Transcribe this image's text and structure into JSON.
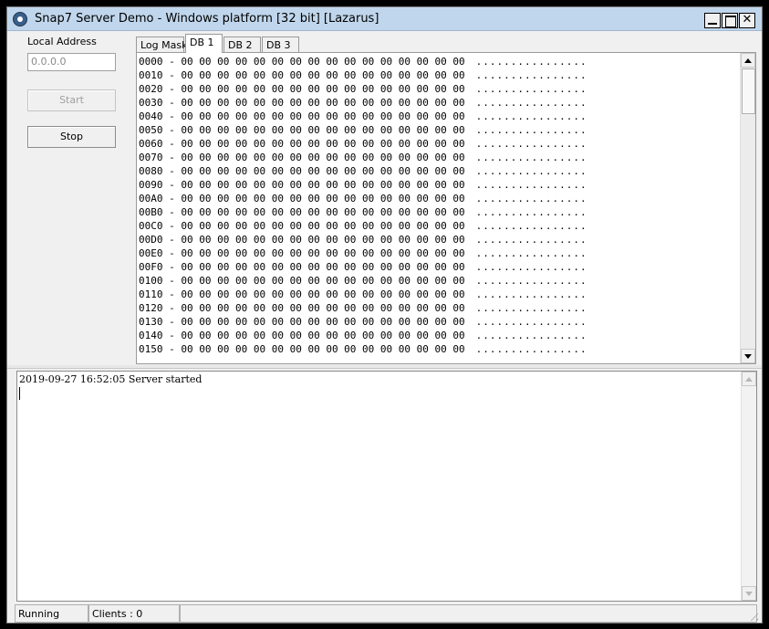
{
  "window": {
    "title": "Snap7 Server Demo - Windows platform [32 bit] [Lazarus]",
    "icon": "snap7-app-icon"
  },
  "controls": {
    "local_address_label": "Local Address",
    "local_address_value": "0.0.0.0",
    "start_label": "Start",
    "stop_label": "Stop"
  },
  "tabs": [
    {
      "label": "Log Mask",
      "active": false
    },
    {
      "label": "DB 1",
      "active": true
    },
    {
      "label": "DB 2",
      "active": false
    },
    {
      "label": "DB 3",
      "active": false
    }
  ],
  "hex_view": {
    "rows": [
      {
        "offset": "0000",
        "bytes": "00 00 00 00 00 00 00 00 00 00 00 00 00 00 00 00",
        "ascii": "................"
      },
      {
        "offset": "0010",
        "bytes": "00 00 00 00 00 00 00 00 00 00 00 00 00 00 00 00",
        "ascii": "................"
      },
      {
        "offset": "0020",
        "bytes": "00 00 00 00 00 00 00 00 00 00 00 00 00 00 00 00",
        "ascii": "................"
      },
      {
        "offset": "0030",
        "bytes": "00 00 00 00 00 00 00 00 00 00 00 00 00 00 00 00",
        "ascii": "................"
      },
      {
        "offset": "0040",
        "bytes": "00 00 00 00 00 00 00 00 00 00 00 00 00 00 00 00",
        "ascii": "................"
      },
      {
        "offset": "0050",
        "bytes": "00 00 00 00 00 00 00 00 00 00 00 00 00 00 00 00",
        "ascii": "................"
      },
      {
        "offset": "0060",
        "bytes": "00 00 00 00 00 00 00 00 00 00 00 00 00 00 00 00",
        "ascii": "................"
      },
      {
        "offset": "0070",
        "bytes": "00 00 00 00 00 00 00 00 00 00 00 00 00 00 00 00",
        "ascii": "................"
      },
      {
        "offset": "0080",
        "bytes": "00 00 00 00 00 00 00 00 00 00 00 00 00 00 00 00",
        "ascii": "................"
      },
      {
        "offset": "0090",
        "bytes": "00 00 00 00 00 00 00 00 00 00 00 00 00 00 00 00",
        "ascii": "................"
      },
      {
        "offset": "00A0",
        "bytes": "00 00 00 00 00 00 00 00 00 00 00 00 00 00 00 00",
        "ascii": "................"
      },
      {
        "offset": "00B0",
        "bytes": "00 00 00 00 00 00 00 00 00 00 00 00 00 00 00 00",
        "ascii": "................"
      },
      {
        "offset": "00C0",
        "bytes": "00 00 00 00 00 00 00 00 00 00 00 00 00 00 00 00",
        "ascii": "................"
      },
      {
        "offset": "00D0",
        "bytes": "00 00 00 00 00 00 00 00 00 00 00 00 00 00 00 00",
        "ascii": "................"
      },
      {
        "offset": "00E0",
        "bytes": "00 00 00 00 00 00 00 00 00 00 00 00 00 00 00 00",
        "ascii": "................"
      },
      {
        "offset": "00F0",
        "bytes": "00 00 00 00 00 00 00 00 00 00 00 00 00 00 00 00",
        "ascii": "................"
      },
      {
        "offset": "0100",
        "bytes": "00 00 00 00 00 00 00 00 00 00 00 00 00 00 00 00",
        "ascii": "................"
      },
      {
        "offset": "0110",
        "bytes": "00 00 00 00 00 00 00 00 00 00 00 00 00 00 00 00",
        "ascii": "................"
      },
      {
        "offset": "0120",
        "bytes": "00 00 00 00 00 00 00 00 00 00 00 00 00 00 00 00",
        "ascii": "................"
      },
      {
        "offset": "0130",
        "bytes": "00 00 00 00 00 00 00 00 00 00 00 00 00 00 00 00",
        "ascii": "................"
      },
      {
        "offset": "0140",
        "bytes": "00 00 00 00 00 00 00 00 00 00 00 00 00 00 00 00",
        "ascii": "................"
      },
      {
        "offset": "0150",
        "bytes": "00 00 00 00 00 00 00 00 00 00 00 00 00 00 00 00",
        "ascii": "................"
      }
    ]
  },
  "log": {
    "lines": [
      "2019-09-27 16:52:05 Server started"
    ]
  },
  "status": {
    "state": "Running",
    "clients": "Clients : 0"
  },
  "colors": {
    "titlebar": "#c0d6ec",
    "window_bg": "#f0f0f0",
    "panel_bg": "#ffffff",
    "disabled_text": "#a0a0a0"
  }
}
